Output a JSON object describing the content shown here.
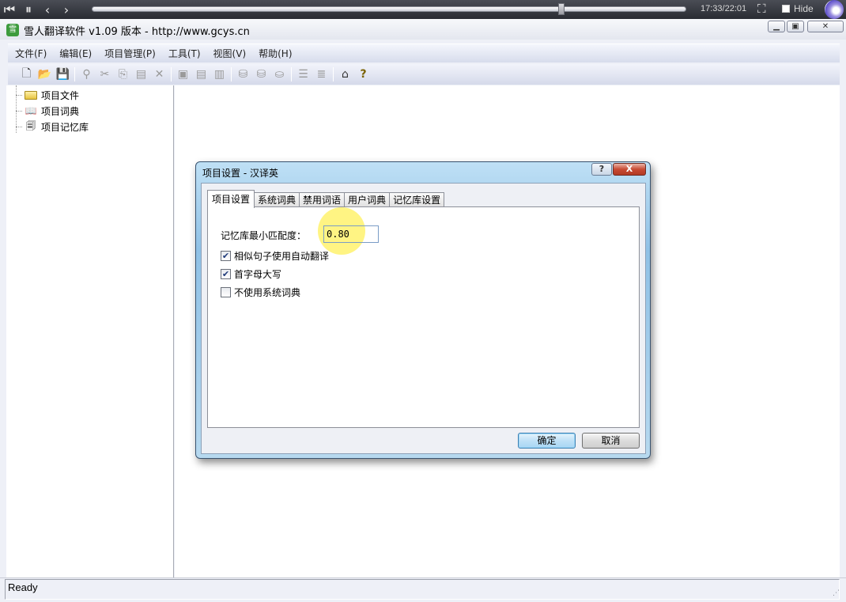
{
  "player": {
    "time": "17:33/22:01",
    "hide_label": "Hide",
    "progress": 0.79
  },
  "window": {
    "title": "雪人翻译软件 v1.09 版本 - http://www.gcys.cn",
    "icon_text": "雪"
  },
  "menu": [
    "文件(F)",
    "编辑(E)",
    "项目管理(P)",
    "工具(T)",
    "视图(V)",
    "帮助(H)"
  ],
  "toolbar": {
    "icons": [
      "new-file-icon",
      "open-folder-icon",
      "save-icon",
      "find-icon",
      "cut-icon",
      "copy-icon",
      "paste-icon",
      "delete-icon",
      "doc-a-icon",
      "doc-b-icon",
      "doc-c-icon",
      "db-a-icon",
      "db-b-icon",
      "db-c-icon",
      "list-icon",
      "list-b-icon",
      "home-icon",
      "help-icon"
    ]
  },
  "tree": {
    "items": [
      {
        "label": "项目文件",
        "icon": "folder-icon"
      },
      {
        "label": "项目词典",
        "icon": "book-icon"
      },
      {
        "label": "项目记忆库",
        "icon": "memory-icon"
      }
    ]
  },
  "status": {
    "text": "Ready"
  },
  "dialog": {
    "title": "项目设置 - 汉译英",
    "help": "?",
    "close": "X",
    "tabs": [
      "项目设置",
      "系统词典",
      "禁用词语",
      "用户词典",
      "记忆库设置"
    ],
    "field_label": "记忆库最小匹配度：",
    "field_value": "0.80",
    "checks": [
      {
        "label": "相似句子使用自动翻译",
        "checked": true
      },
      {
        "label": "首字母大写",
        "checked": true
      },
      {
        "label": "不使用系统词典",
        "checked": false
      }
    ],
    "ok": "确定",
    "cancel": "取消"
  }
}
